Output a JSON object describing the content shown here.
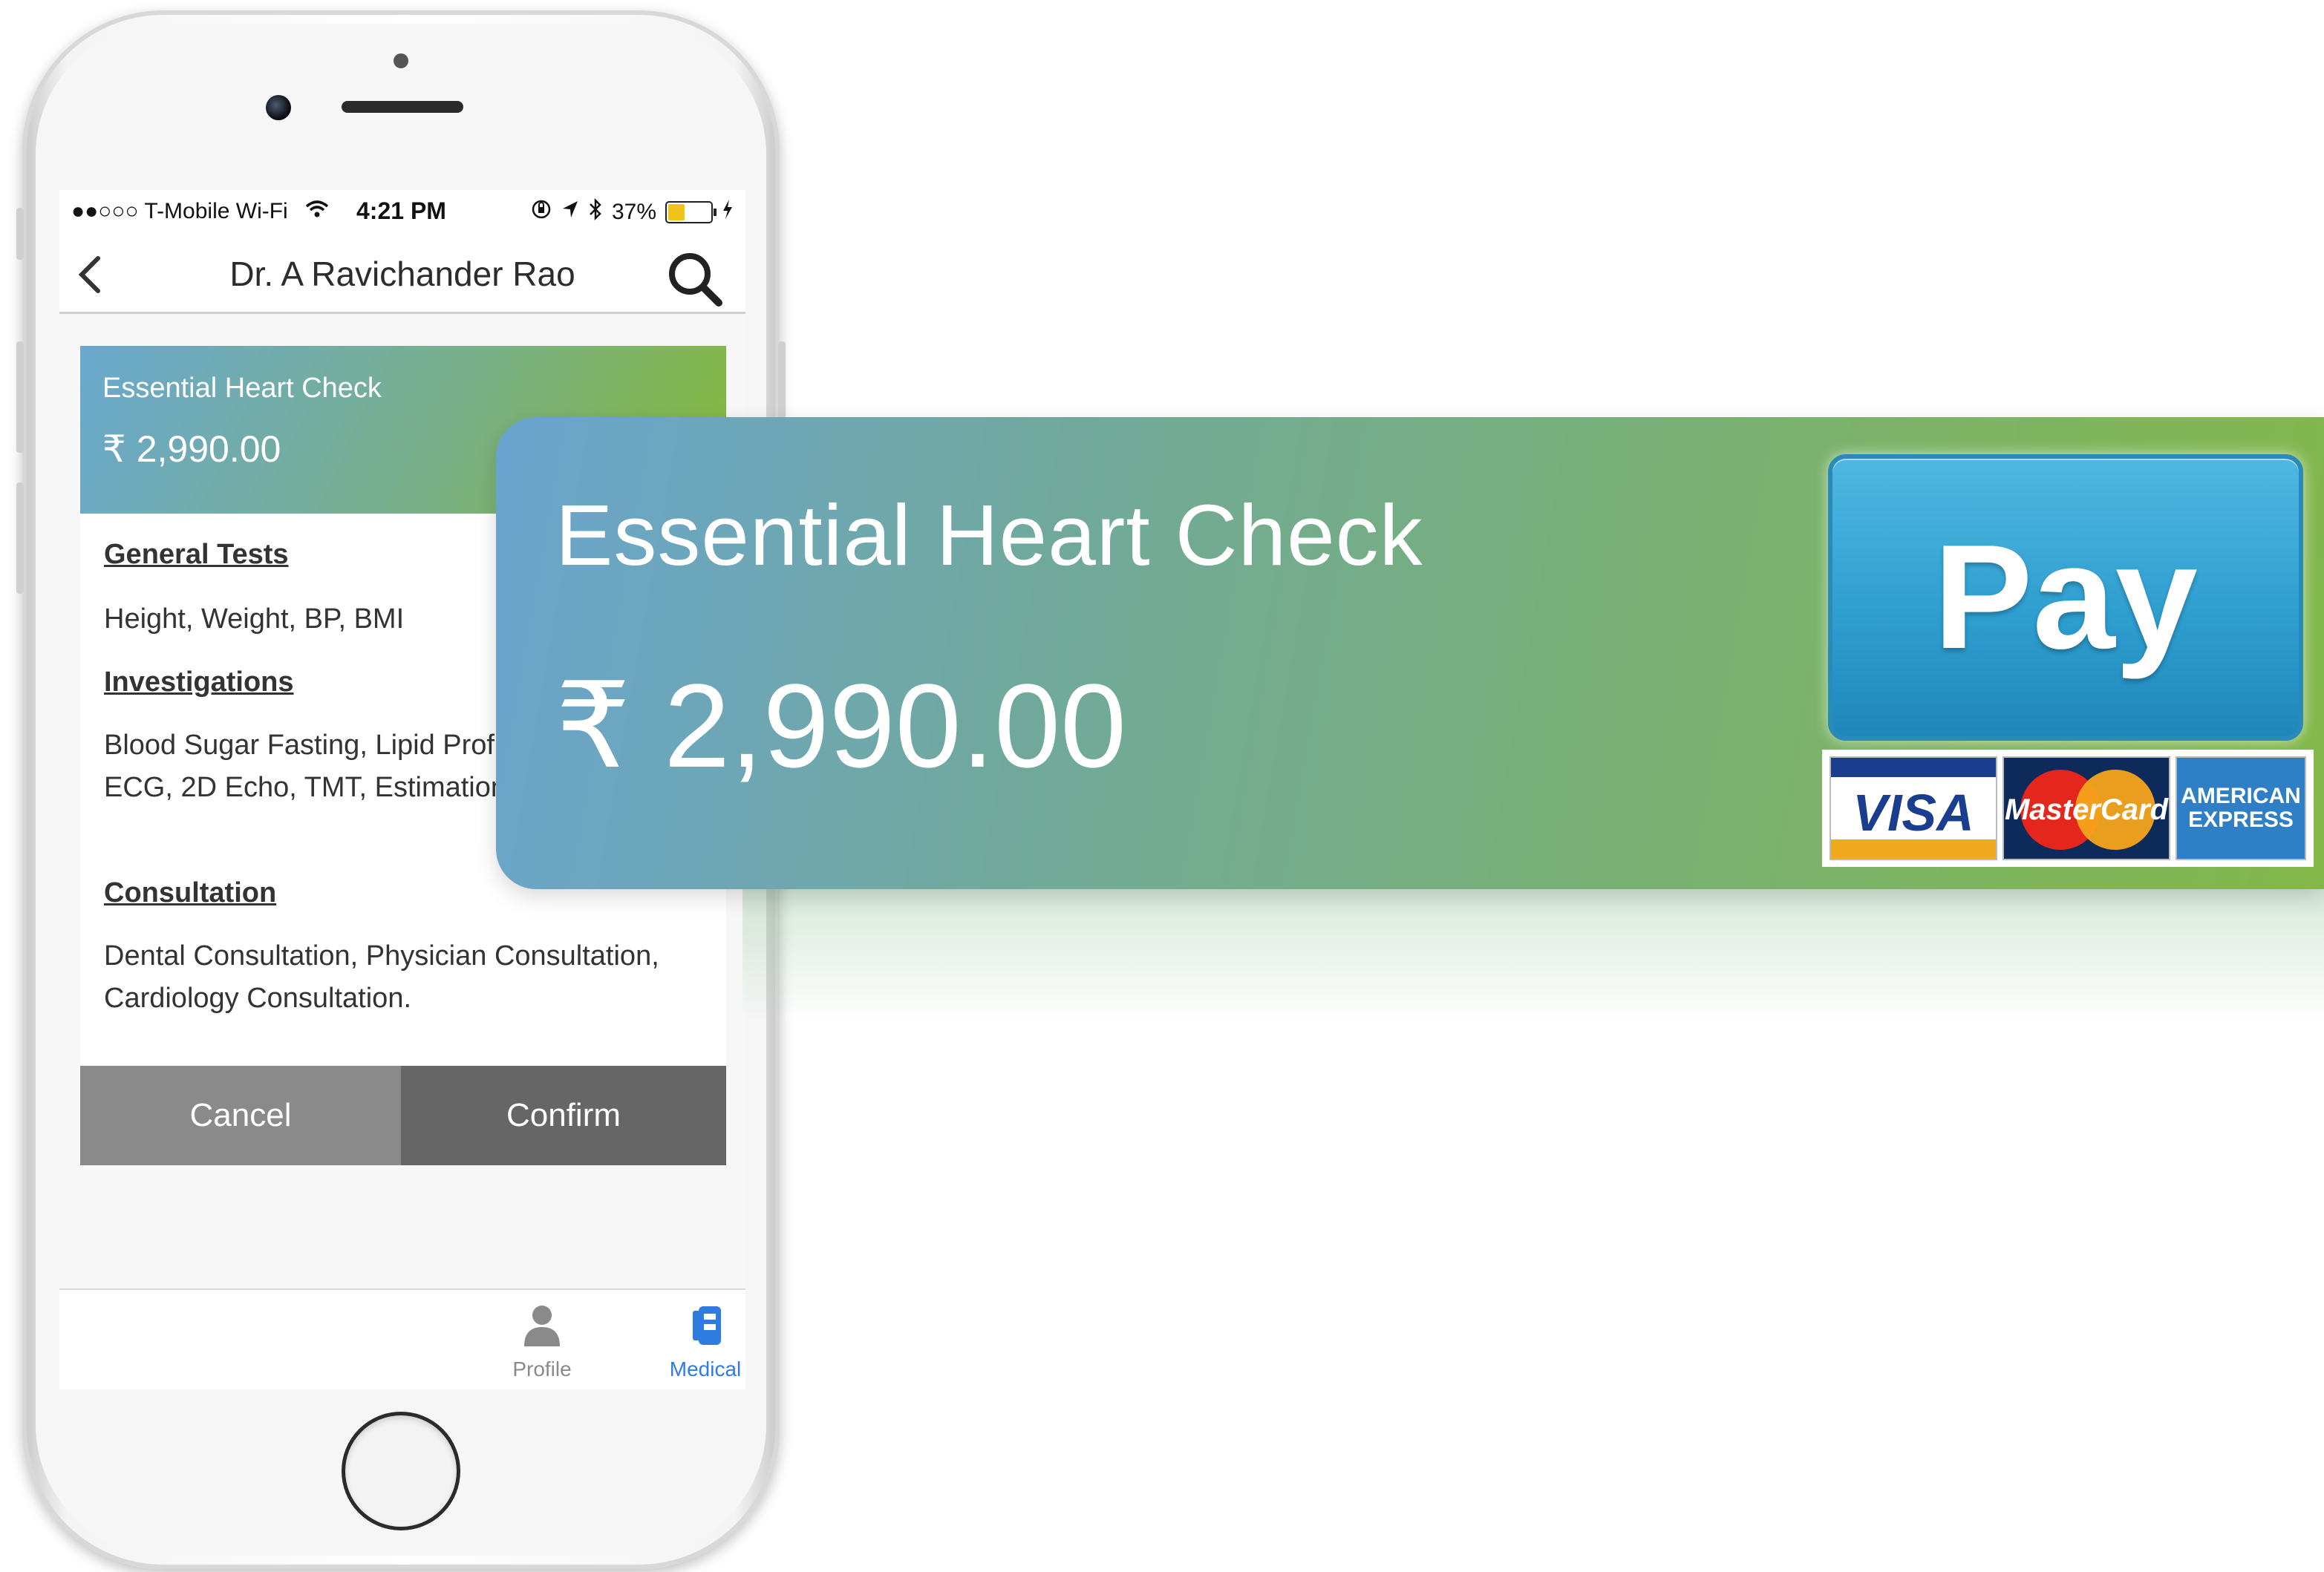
{
  "status_bar": {
    "carrier": "●●○○○ T-Mobile Wi-Fi",
    "time": "4:21 PM",
    "battery": "37%",
    "battery_level": 0.37
  },
  "nav": {
    "title": "Dr. A Ravichander Rao"
  },
  "package": {
    "name": "Essential Heart Check",
    "price": "₹ 2,990.00",
    "sections": [
      {
        "title": "General Tests",
        "text": "Height, Weight, BP, BMI"
      },
      {
        "title": "Investigations",
        "text": "Blood Sugar Fasting, Lipid Profile, Creatinine, ECG, 2D Echo, TMT, Estimation."
      },
      {
        "title": "Consultation",
        "text": "Dental Consultation, Physician Consultation, Cardiology Consultation."
      }
    ]
  },
  "actions": {
    "cancel": "Cancel",
    "confirm": "Confirm"
  },
  "tabbar": {
    "profile": "Profile",
    "medical": "Medical",
    "active": "Medical",
    "active_color": "#2f7be0",
    "inactive_color": "#8a8a8a"
  },
  "banner": {
    "title": "Essential Heart Check",
    "price": "₹ 2,990.00",
    "pay_label": "Pay",
    "card_logos": {
      "visa": "VISA",
      "mastercard": "MasterCard",
      "amex_line1": "AMERICAN",
      "amex_line2": "EXPRESS"
    }
  }
}
